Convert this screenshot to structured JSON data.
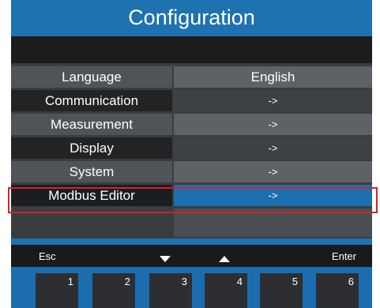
{
  "title": "Configuration",
  "menu": [
    {
      "label": "Language",
      "value": "English"
    },
    {
      "label": "Communication",
      "value": "->"
    },
    {
      "label": "Measurement",
      "value": "->"
    },
    {
      "label": "Display",
      "value": "->"
    },
    {
      "label": "System",
      "value": "->"
    },
    {
      "label": "Modbus Editor",
      "value": "->",
      "selected": true
    }
  ],
  "softkeys": {
    "left": "Esc",
    "down_icon": "triangle-down-icon",
    "up_icon": "triangle-up-icon",
    "right": "Enter"
  },
  "keys": [
    "1",
    "2",
    "3",
    "4",
    "5",
    "6"
  ],
  "colors": {
    "accent_blue": "#1e72b0",
    "highlight_red": "#d3232b",
    "selected_value": "#1d6fb0"
  }
}
